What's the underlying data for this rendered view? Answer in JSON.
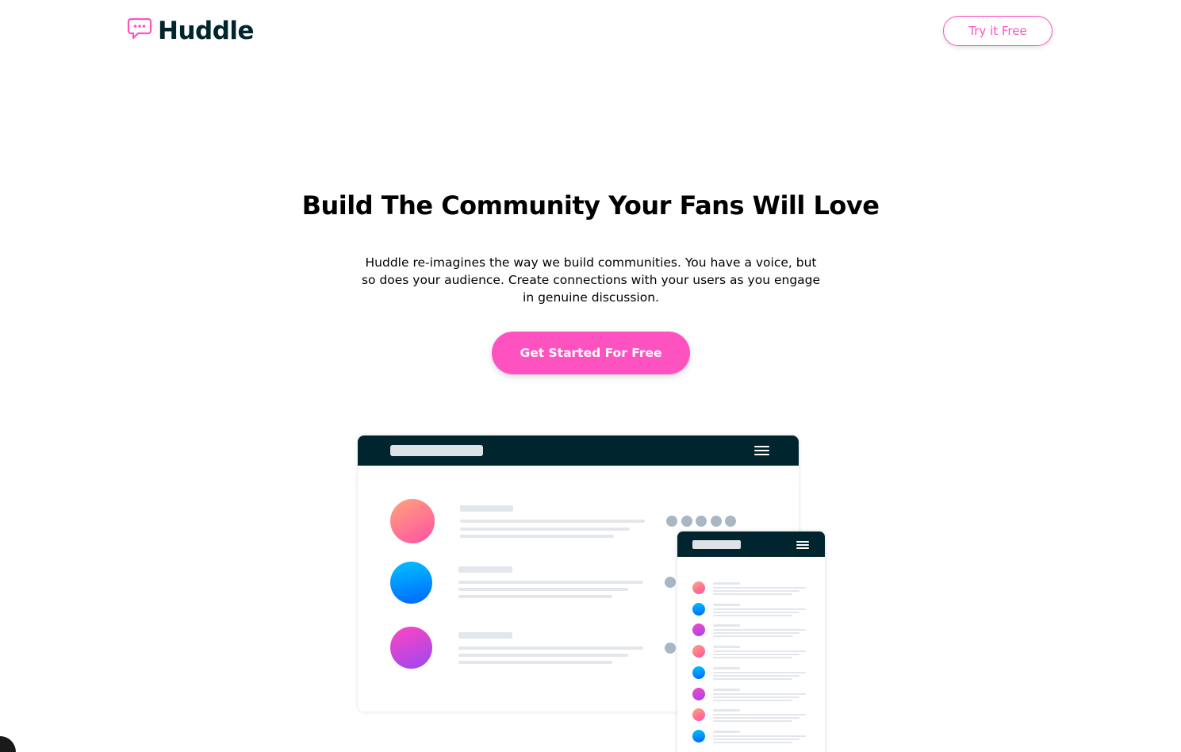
{
  "header": {
    "logo_text": "Huddle",
    "logo_icon": "chat-bubble-icon",
    "try_button_label": "Try it Free"
  },
  "hero": {
    "title": "Build The Community Your Fans Will Love",
    "description": "Huddle re-imagines the way we build communities. You have a voice, but so does your audience. Create connections with your users as you engage in genuine discussion.",
    "cta_label": "Get Started For Free"
  },
  "colors": {
    "accent_pink": "#ff52c1",
    "dark_navy": "#00252e",
    "placeholder_gray": "#e3e7ec",
    "dot_gray": "#a9b7c3"
  },
  "illustration": {
    "desktop_icon": "hamburger-menu-icon",
    "mobile_icon": "hamburger-menu-icon",
    "desktop_avatar_gradients": [
      "orange",
      "blue",
      "purple"
    ],
    "mobile_avatar_gradients": [
      "orange",
      "blue",
      "purple",
      "orange",
      "blue",
      "purple",
      "orange",
      "blue"
    ]
  }
}
